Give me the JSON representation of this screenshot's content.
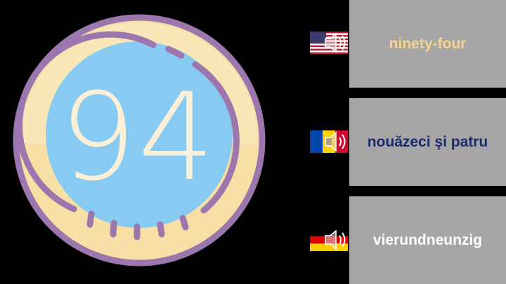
{
  "number": "94",
  "colors": {
    "ring_purple": "#9b77ad",
    "ring_cream": "#f7dfa6",
    "ring_cream_light": "#fbe9bf",
    "face_blue": "#87cbf3",
    "numeral": "#fbf0d7",
    "panel_gray": "#a6a6a6"
  },
  "translations": [
    {
      "language": "English",
      "flag": "us-flag-icon",
      "word": "ninety-four",
      "color": "#f6d38f"
    },
    {
      "language": "Romanian (Moldova)",
      "flag": "moldova-flag-icon",
      "word": "nouăzeci şi patru",
      "color": "#1b2a6b"
    },
    {
      "language": "German",
      "flag": "germany-flag-icon",
      "word": "vierundneunzig",
      "color": "#ffffff"
    }
  ]
}
